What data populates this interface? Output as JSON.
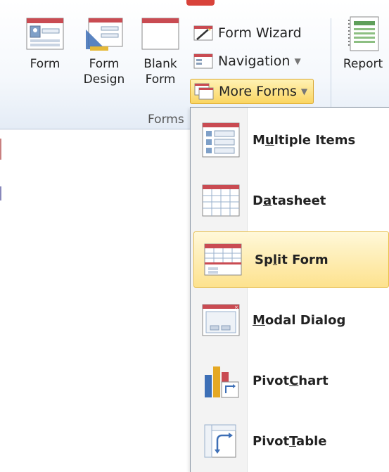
{
  "ribbon": {
    "buttons": {
      "form": {
        "label": "Form",
        "icon": "form-icon"
      },
      "form_design": {
        "label_line1": "Form",
        "label_line2": "Design",
        "icon": "form-design-icon"
      },
      "blank_form": {
        "label_line1": "Blank",
        "label_line2": "Form",
        "icon": "blank-form-icon"
      },
      "report": {
        "label": "Report",
        "icon": "report-icon"
      }
    },
    "small_buttons": {
      "form_wizard": {
        "label": "Form Wizard",
        "icon": "form-wizard-icon"
      },
      "navigation": {
        "label": "Navigation",
        "icon": "navigation-icon"
      },
      "more_forms": {
        "label": "More Forms",
        "icon": "more-forms-icon"
      }
    },
    "group_label": "Forms"
  },
  "menu": {
    "items": [
      {
        "label_pre": "M",
        "label_u": "u",
        "label_post": "ltiple Items",
        "icon": "multiple-items-icon"
      },
      {
        "label_pre": "D",
        "label_u": "a",
        "label_post": "tasheet",
        "icon": "datasheet-icon"
      },
      {
        "label_pre": "Sp",
        "label_u": "l",
        "label_post": "it Form",
        "icon": "split-form-icon",
        "highlighted": true
      },
      {
        "label_pre": "",
        "label_u": "M",
        "label_post": "odal Dialog",
        "icon": "modal-dialog-icon"
      },
      {
        "label_pre": "Pivot",
        "label_u": "C",
        "label_post": "hart",
        "icon": "pivotchart-icon"
      },
      {
        "label_pre": "Pivot",
        "label_u": "T",
        "label_post": "able",
        "icon": "pivottable-icon"
      }
    ]
  },
  "colors": {
    "highlight": "#fde28e",
    "ribbon_bg": "#f5f8fc",
    "menu_border": "#8f9aa8"
  }
}
